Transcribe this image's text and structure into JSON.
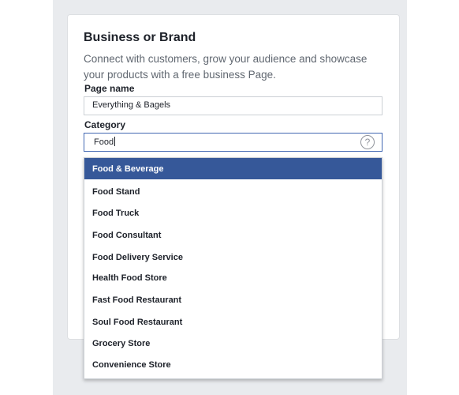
{
  "form": {
    "title": "Business or Brand",
    "description": "Connect with customers, grow your audience and showcase your products with a free business Page.",
    "page_name_label": "Page name",
    "page_name_value": "Everything & Bagels",
    "category_label": "Category",
    "category_value": "Food",
    "help_icon_glyph": "?"
  },
  "dropdown": {
    "selected_index": 0,
    "options": [
      "Food & Beverage",
      "Food Stand",
      "Food Truck",
      "Food Consultant",
      "Food Delivery Service",
      "Health Food Store",
      "Fast Food Restaurant",
      "Soul Food Restaurant",
      "Grocery Store",
      "Convenience Store"
    ]
  },
  "colors": {
    "accent": "#365899",
    "focus_border": "#4267b2",
    "page_bg": "#e9ebee"
  }
}
